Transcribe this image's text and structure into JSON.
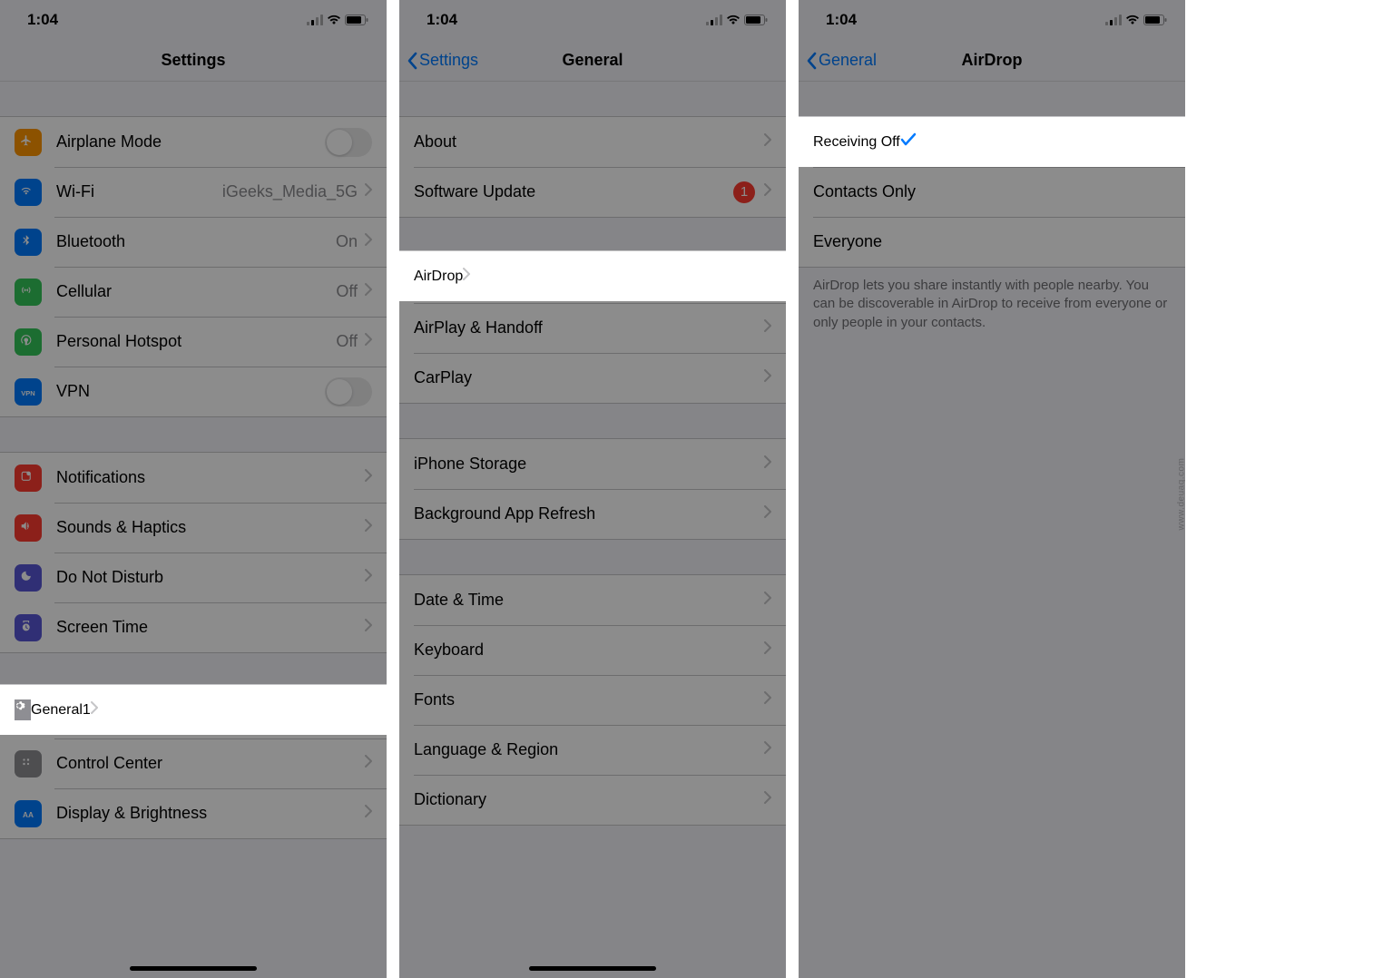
{
  "status": {
    "time": "1:04"
  },
  "watermark": "www.deuaq.com",
  "screen1": {
    "title": "Settings",
    "groups": [
      {
        "rows": [
          {
            "icon": "airplane",
            "color": "#ff9500",
            "label": "Airplane Mode",
            "accessory": "toggle"
          },
          {
            "icon": "wifi",
            "color": "#007aff",
            "label": "Wi-Fi",
            "value": "iGeeks_Media_5G",
            "accessory": "chevron"
          },
          {
            "icon": "bluetooth",
            "color": "#007aff",
            "label": "Bluetooth",
            "value": "On",
            "accessory": "chevron"
          },
          {
            "icon": "cellular",
            "color": "#34c759",
            "label": "Cellular",
            "value": "Off",
            "accessory": "chevron"
          },
          {
            "icon": "hotspot",
            "color": "#34c759",
            "label": "Personal Hotspot",
            "value": "Off",
            "accessory": "chevron"
          },
          {
            "icon": "vpn",
            "color": "#007aff",
            "label": "VPN",
            "accessory": "toggle"
          }
        ]
      },
      {
        "rows": [
          {
            "icon": "notifications",
            "color": "#ff3b30",
            "label": "Notifications",
            "accessory": "chevron"
          },
          {
            "icon": "sounds",
            "color": "#ff3b30",
            "label": "Sounds & Haptics",
            "accessory": "chevron"
          },
          {
            "icon": "dnd",
            "color": "#5856d6",
            "label": "Do Not Disturb",
            "accessory": "chevron"
          },
          {
            "icon": "screentime",
            "color": "#5856d6",
            "label": "Screen Time",
            "accessory": "chevron"
          }
        ]
      },
      {
        "rows": [
          {
            "icon": "general",
            "color": "#8e8e93",
            "label": "General",
            "badge": "1",
            "accessory": "chevron",
            "highlight": true
          },
          {
            "icon": "controlcenter",
            "color": "#8e8e93",
            "label": "Control Center",
            "accessory": "chevron"
          },
          {
            "icon": "display",
            "color": "#007aff",
            "label": "Display & Brightness",
            "accessory": "chevron"
          }
        ]
      }
    ]
  },
  "screen2": {
    "back": "Settings",
    "title": "General",
    "groups": [
      {
        "rows": [
          {
            "label": "About",
            "accessory": "chevron"
          },
          {
            "label": "Software Update",
            "badge": "1",
            "accessory": "chevron"
          }
        ]
      },
      {
        "rows": [
          {
            "label": "AirDrop",
            "accessory": "chevron",
            "highlight": true
          },
          {
            "label": "AirPlay & Handoff",
            "accessory": "chevron"
          },
          {
            "label": "CarPlay",
            "accessory": "chevron"
          }
        ]
      },
      {
        "rows": [
          {
            "label": "iPhone Storage",
            "accessory": "chevron"
          },
          {
            "label": "Background App Refresh",
            "accessory": "chevron"
          }
        ]
      },
      {
        "rows": [
          {
            "label": "Date & Time",
            "accessory": "chevron"
          },
          {
            "label": "Keyboard",
            "accessory": "chevron"
          },
          {
            "label": "Fonts",
            "accessory": "chevron"
          },
          {
            "label": "Language & Region",
            "accessory": "chevron"
          },
          {
            "label": "Dictionary",
            "accessory": "chevron"
          }
        ]
      }
    ]
  },
  "screen3": {
    "back": "General",
    "title": "AirDrop",
    "rows": [
      {
        "label": "Receiving Off",
        "accessory": "check",
        "highlight": true
      },
      {
        "label": "Contacts Only"
      },
      {
        "label": "Everyone"
      }
    ],
    "footer": "AirDrop lets you share instantly with people nearby. You can be discoverable in AirDrop to receive from everyone or only people in your contacts."
  }
}
